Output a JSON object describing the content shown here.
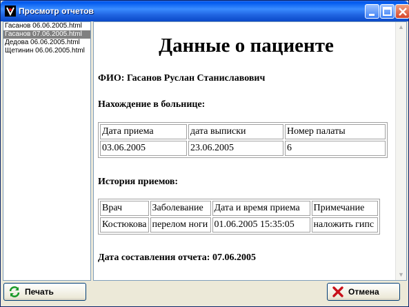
{
  "window": {
    "title": "Просмотр отчетов"
  },
  "files": [
    {
      "label": "Гасанов 06.06.2005.html",
      "selected": false
    },
    {
      "label": "Гасанов 07.06.2005.html",
      "selected": true
    },
    {
      "label": "Дедова 06.06.2005.html",
      "selected": false
    },
    {
      "label": "Щетинин 06.06.2005.html",
      "selected": false
    }
  ],
  "report": {
    "heading": "Данные о пациенте",
    "fio": "ФИО: Гасанов Руслан Станиславович",
    "stay_title": "Нахождение в больнице:",
    "stay_table": {
      "headers": [
        "Дата приема",
        "дата выписки",
        "Номер палаты"
      ],
      "row": [
        "03.06.2005",
        "23.06.2005",
        "6"
      ]
    },
    "history_title": "История приемов:",
    "history_table": {
      "headers": [
        "Врач",
        "Заболевание",
        "Дата и время приема",
        "Примечание"
      ],
      "row": [
        "Костюкова",
        "перелом ноги",
        "01.06.2005 15:35:05",
        "наложить гипс"
      ]
    },
    "created": "Дата составления отчета: 07.06.2005"
  },
  "buttons": {
    "print": "Печать",
    "cancel": "Отмена"
  },
  "colors": {
    "title_bar": "#1f63e0",
    "selection": "#808080",
    "close": "#d6452a"
  },
  "icons": {
    "print": "refresh-arrows-icon",
    "cancel": "red-x-icon"
  }
}
